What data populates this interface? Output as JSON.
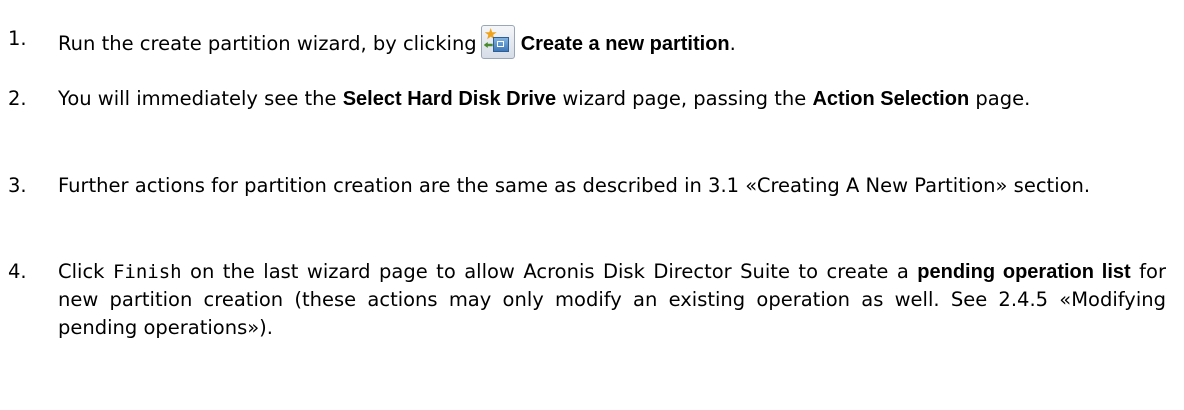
{
  "steps": [
    {
      "number": "1.",
      "intro": "Run the create partition wizard, by clicking",
      "icon": "create-partition-icon",
      "bold": "Create a new partition",
      "tail": "."
    },
    {
      "number": "2.",
      "t1": "You will immediately see the ",
      "b1": "Select Hard Disk Drive",
      "t2": " wizard page, passing the ",
      "b2": "Action Selection",
      "t3": " page."
    },
    {
      "number": "3.",
      "text": "Further actions for partition creation are the same as described in 3.1 «Creating A New Partition» section."
    },
    {
      "number": "4.",
      "t1": "Click ",
      "code": "Finish",
      "t2": " on the last wizard page to allow Acronis Disk Director Suite to create a ",
      "b1": "pending operation list",
      "t3": " for new partition creation (these actions may only modify an existing operation as well. See 2.4.5 «Modifying pending operations»)."
    }
  ]
}
